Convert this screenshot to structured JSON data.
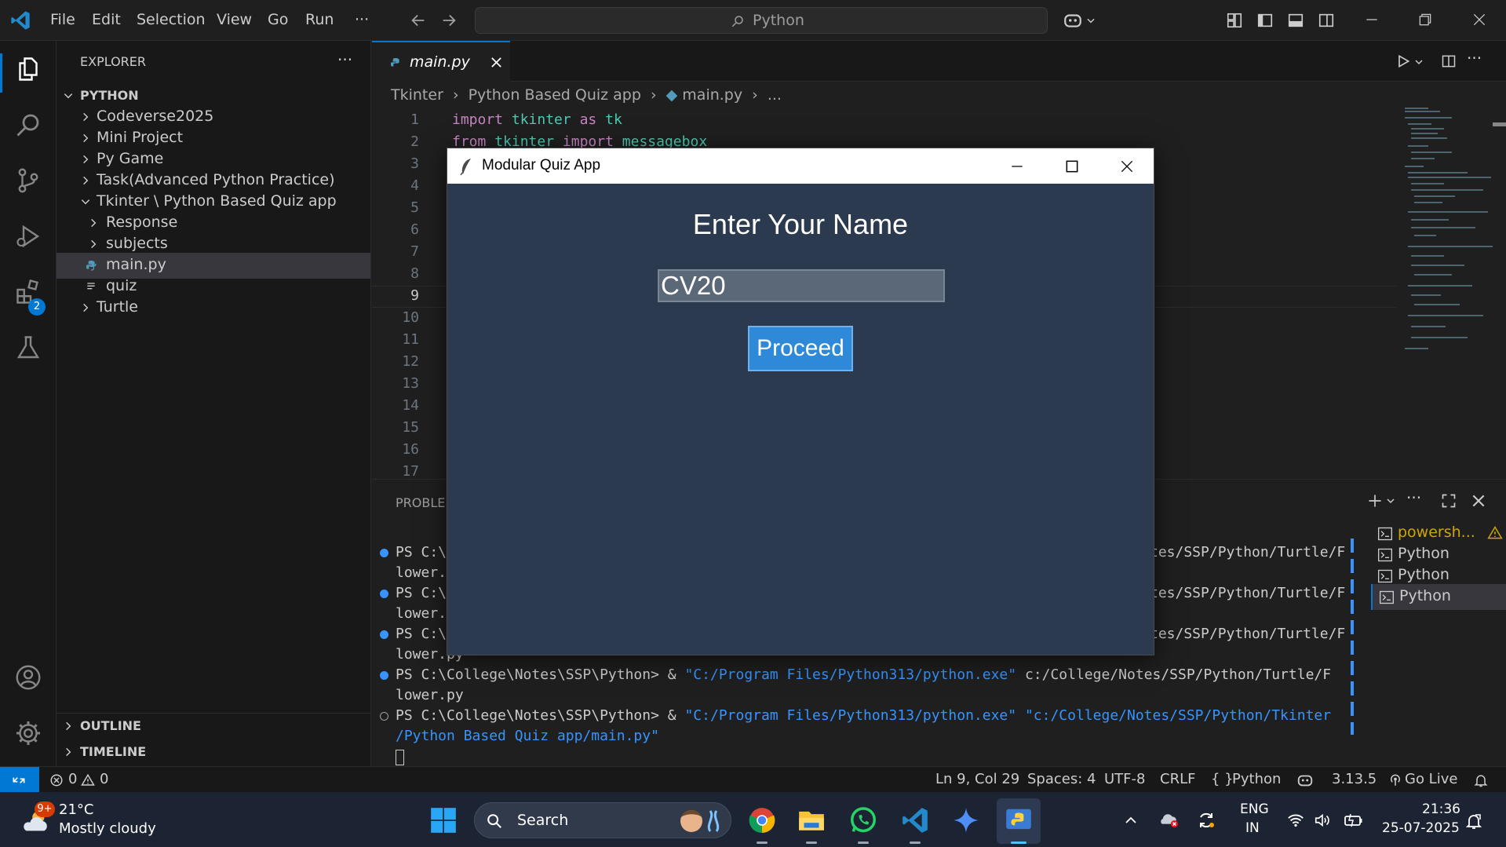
{
  "menu": {
    "file": "File",
    "edit": "Edit",
    "selection": "Selection",
    "view": "View",
    "go": "Go",
    "run": "Run",
    "more": "···"
  },
  "search": {
    "label": "Python"
  },
  "activity": {
    "extensions_badge": "2"
  },
  "explorer": {
    "title": "EXPLORER",
    "more": "···",
    "root": "PYTHON",
    "items": [
      {
        "label": "Codeverse2025"
      },
      {
        "label": "Mini Project"
      },
      {
        "label": "Py Game"
      },
      {
        "label": "Task(Advanced Python Practice)"
      },
      {
        "label": "Tkinter \\ Python Based Quiz app"
      },
      {
        "label": "Response"
      },
      {
        "label": "subjects"
      },
      {
        "label": "main.py"
      },
      {
        "label": "quiz"
      },
      {
        "label": "Turtle"
      }
    ],
    "outline": "OUTLINE",
    "timeline": "TIMELINE"
  },
  "editor": {
    "tab": "main.py",
    "breadcrumb": {
      "a": "Tkinter",
      "b": "Python Based Quiz app",
      "c": "main.py",
      "d": "..."
    },
    "line_numbers": [
      "1",
      "2",
      "3",
      "4",
      "5",
      "6",
      "7",
      "8",
      "9",
      "10",
      "11",
      "12",
      "13",
      "14",
      "15",
      "16",
      "17"
    ],
    "code": {
      "l1_kw": "import",
      "l1_mod": "tkinter",
      "l1_as": "as",
      "l1_alias": "tk",
      "l2_kw": "from",
      "l2_mod": "tkinter",
      "l2_imp": "import",
      "l2_name": "messagebox"
    }
  },
  "panel": {
    "tab": "PROBLEMS",
    "terminal_lines": [
      {
        "a": "PS C:\\",
        "b": "tes/SSP/Python/Turtle/F"
      },
      {
        "a": "lower."
      },
      {
        "a": "PS C:\\",
        "b": "tes/SSP/Python/Turtle/F"
      },
      {
        "a": "lower."
      },
      {
        "a": "PS C:\\",
        "b": "tes/SSP/Python/Turtle/F"
      },
      {
        "a": "lower.py"
      },
      {
        "prompt": "PS C:\\College\\Notes\\SSP\\Python> ",
        "amp": "& ",
        "exe": "\"C:/Program Files/Python313/python.exe\"",
        "rest": " c:/College/Notes/SSP/Python/Turtle/F"
      },
      {
        "a": "lower.py"
      },
      {
        "prompt": "PS C:\\College\\Notes\\SSP\\Python> ",
        "amp": "& ",
        "exe": "\"C:/Program Files/Python313/python.exe\"",
        "rest": " \"c:/College/Notes/SSP/Python/Tkinter"
      },
      {
        "a": "/Python Based Quiz app/main.py\""
      }
    ],
    "terminals": [
      {
        "label": "powersh..."
      },
      {
        "label": "Python"
      },
      {
        "label": "Python"
      },
      {
        "label": "Python"
      }
    ]
  },
  "statusbar": {
    "errors": "0",
    "warnings": "0",
    "position": "Ln 9, Col 29",
    "spaces": "Spaces: 4",
    "encoding": "UTF-8",
    "eol": "CRLF",
    "lang_braces": "{ }",
    "language": "Python",
    "version": "3.13.5",
    "golive": "Go Live"
  },
  "taskbar": {
    "weather_temp": "21°C",
    "weather_desc": "Mostly cloudy",
    "weather_badge": "9+",
    "search": "Search",
    "lang1": "ENG",
    "lang2": "IN",
    "time": "21:36",
    "date": "25-07-2025"
  },
  "quiz": {
    "title": "Modular Quiz App",
    "heading": "Enter Your Name",
    "name_value": "CV20",
    "proceed": "Proceed"
  },
  "colors": {
    "accent": "#0078d4",
    "quiz_bg": "#2b3a4e",
    "button": "#2e8ad8",
    "keyword": "#c586c0",
    "module": "#4ec9b0"
  }
}
